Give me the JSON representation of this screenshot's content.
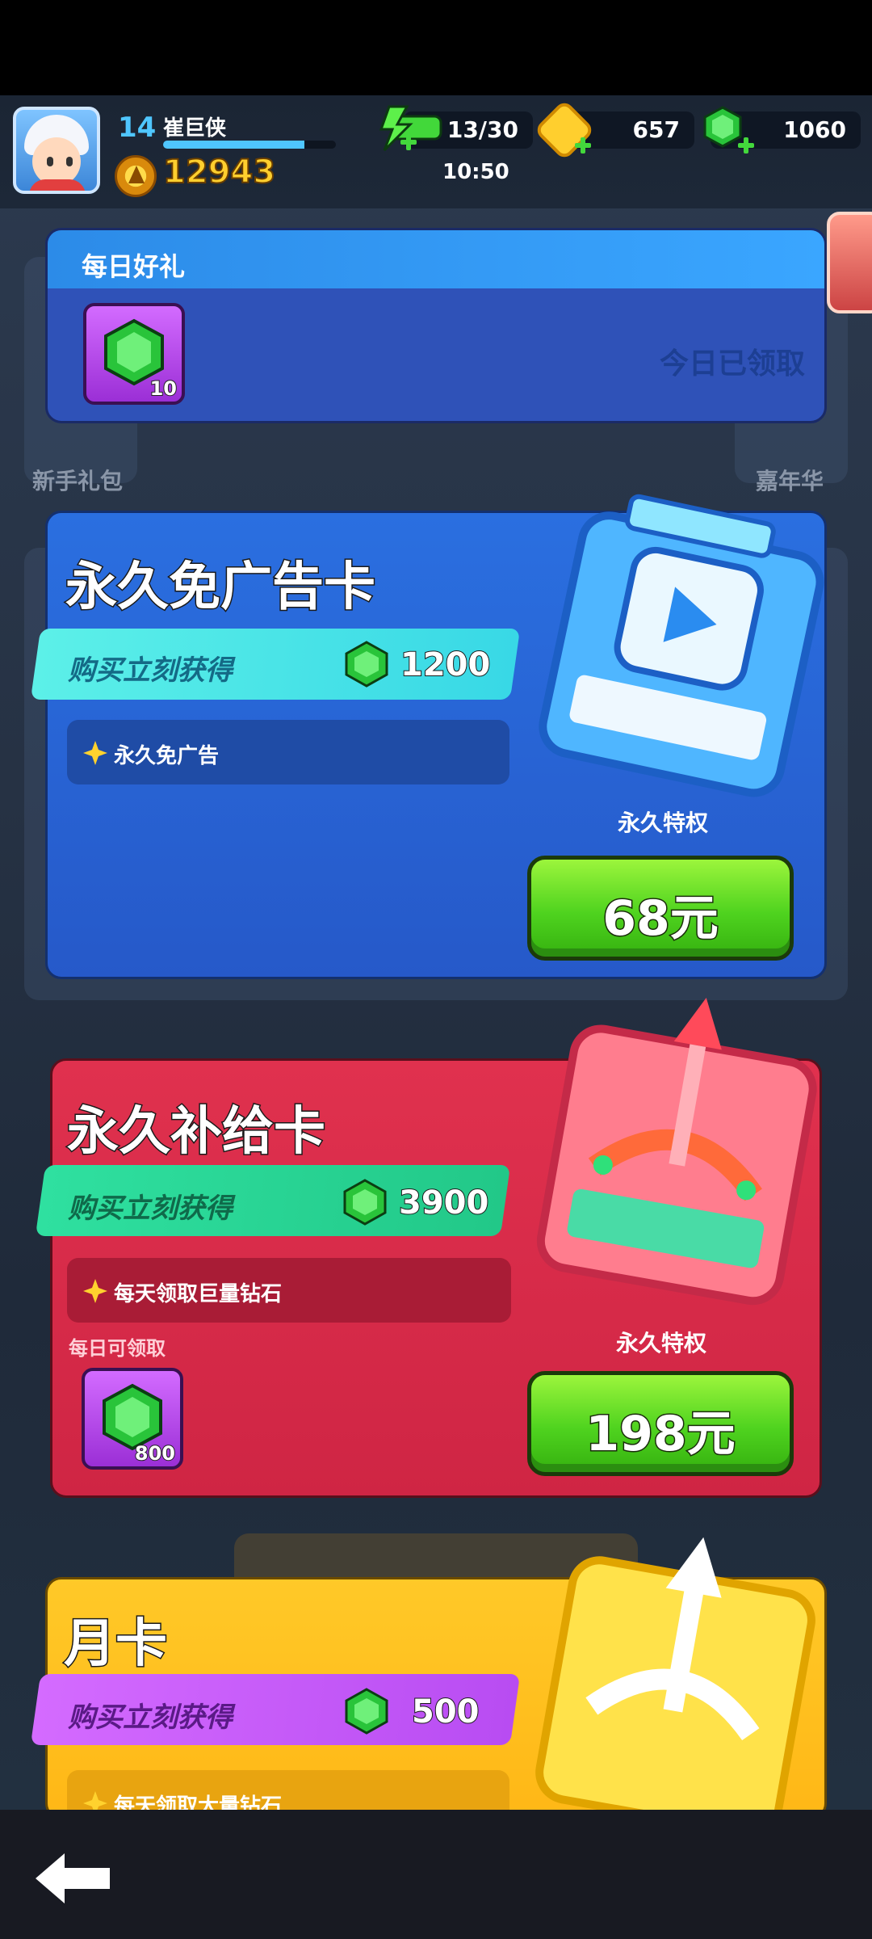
{
  "player": {
    "level": "14",
    "name": "崔巨侠",
    "xp_fraction": 0.82,
    "trophies": "12943"
  },
  "resources": {
    "energy": "13/30",
    "energy_timer": "10:50",
    "coins": "657",
    "gems": "1060"
  },
  "background": {
    "left_label": "新手礼包",
    "right_label": "嘉年华"
  },
  "daily_gift": {
    "title": "每日好礼",
    "item_count": "10",
    "status": "今日已领取"
  },
  "ad_free_card": {
    "title": "永久免广告卡",
    "ribbon_label": "购买立刻获得",
    "ribbon_amount": "1200",
    "perk": "永久免广告",
    "perm_label": "永久特权",
    "price": "68元"
  },
  "supply_card": {
    "title": "永久补给卡",
    "ribbon_label": "购买立刻获得",
    "ribbon_amount": "3900",
    "perk": "每天领取巨量钻石",
    "daily_label": "每日可领取",
    "item_count": "800",
    "perm_label": "永久特权",
    "price": "198元"
  },
  "monthly_card": {
    "title": "月卡",
    "ribbon_label": "购买立刻获得",
    "ribbon_amount": "500",
    "perk": "每天领取大量钻石"
  },
  "colors": {
    "blue_card": "#2a6fe0",
    "red_card": "#d82a48",
    "yellow_card": "#ffc21f",
    "buy_green": "#4fd31f",
    "gem_green": "#29c43a"
  },
  "icons": [
    "user-avatar",
    "trophy-icon",
    "energy-icon",
    "coin-icon",
    "gem-icon",
    "play-icon",
    "star-icon",
    "back-arrow-icon"
  ]
}
